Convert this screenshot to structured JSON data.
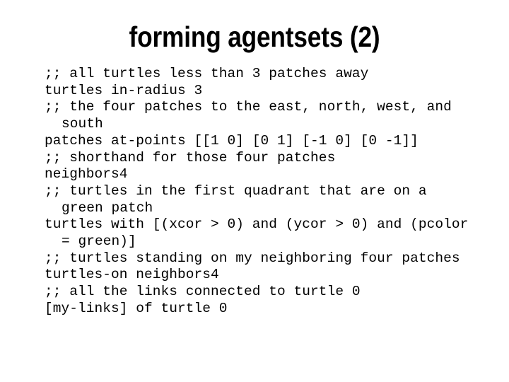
{
  "slide": {
    "title": "forming agentsets (2)",
    "background_color": "#ffffff",
    "text_color": "#000000",
    "lines": [
      ";; all turtles less than 3 patches away",
      "turtles in-radius 3",
      ";; the four patches to the east, north, west, and south",
      "patches at-points [[1 0] [0 1] [-1 0] [0 -1]]",
      ";; shorthand for those four patches",
      "neighbors4",
      ";; turtles in the first quadrant that are on a green patch",
      "turtles with [(xcor > 0) and (ycor > 0) and (pcolor = green)]",
      ";; turtles standing on my neighboring four patches",
      "turtles-on neighbors4",
      ";; all the links connected to turtle 0",
      "[my-links] of turtle 0"
    ]
  }
}
